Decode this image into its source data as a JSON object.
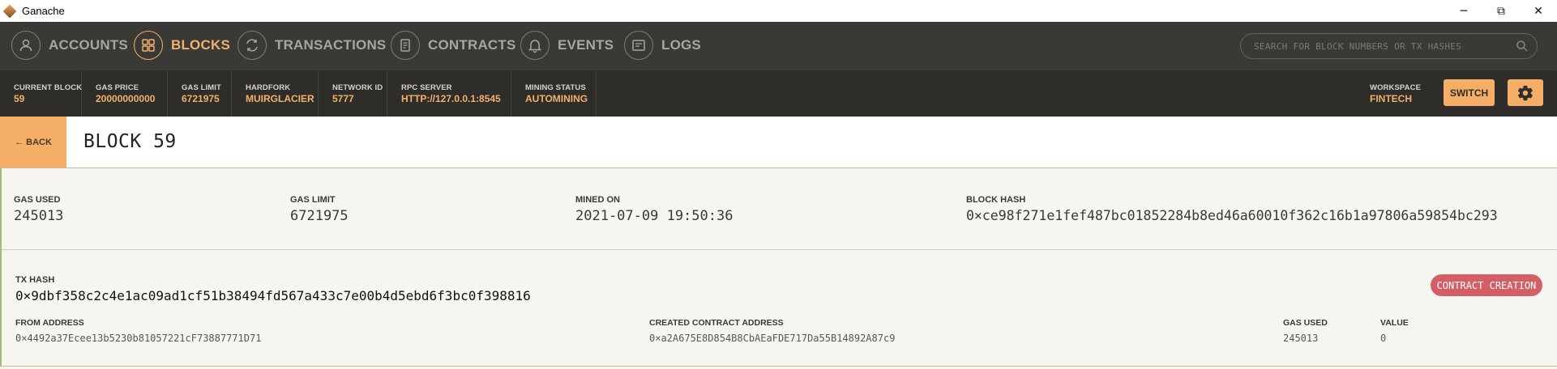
{
  "window": {
    "title": "Ganache",
    "minimize": "─",
    "maximize": "⧉",
    "close": "✕"
  },
  "nav": {
    "items": [
      {
        "label": "ACCOUNTS",
        "icon": "account-icon"
      },
      {
        "label": "BLOCKS",
        "icon": "blocks-icon",
        "active": true
      },
      {
        "label": "TRANSACTIONS",
        "icon": "transactions-icon"
      },
      {
        "label": "CONTRACTS",
        "icon": "contracts-icon"
      },
      {
        "label": "EVENTS",
        "icon": "bell-icon"
      },
      {
        "label": "LOGS",
        "icon": "logs-icon"
      }
    ],
    "search_placeholder": "SEARCH FOR BLOCK NUMBERS OR TX HASHES"
  },
  "status": {
    "current_block_label": "CURRENT BLOCK",
    "current_block": "59",
    "gas_price_label": "GAS PRICE",
    "gas_price": "20000000000",
    "gas_limit_label": "GAS LIMIT",
    "gas_limit": "6721975",
    "hardfork_label": "HARDFORK",
    "hardfork": "MUIRGLACIER",
    "network_id_label": "NETWORK ID",
    "network_id": "5777",
    "rpc_label": "RPC SERVER",
    "rpc": "HTTP://127.0.0.1:8545",
    "mining_label": "MINING STATUS",
    "mining": "AUTOMINING",
    "workspace_label": "WORKSPACE",
    "workspace": "FINTECH",
    "switch_label": "SWITCH"
  },
  "block": {
    "back_label": "← BACK",
    "title": "BLOCK 59",
    "gas_used_label": "GAS USED",
    "gas_used": "245013",
    "gas_limit_label": "GAS LIMIT",
    "gas_limit": "6721975",
    "mined_on_label": "MINED ON",
    "mined_on": "2021-07-09 19:50:36",
    "hash_label": "BLOCK HASH",
    "hash": "0×ce98f271e1fef487bc01852284b8ed46a60010f362c16b1a97806a59854bc293"
  },
  "transaction": {
    "hash_label": "TX HASH",
    "hash": "0×9dbf358c2c4e1ac09ad1cf51b38494fd567a433c7e00b4d5ebd6f3bc0f398816",
    "badge": "CONTRACT CREATION",
    "from_label": "FROM ADDRESS",
    "from": "0×4492a37Ecee13b5230b81057221cF73887771D71",
    "created_label": "CREATED CONTRACT ADDRESS",
    "created": "0×a2A675E8D854B8CbAEaFDE717Da55B14892A87c9",
    "gas_used_label": "GAS USED",
    "gas_used": "245013",
    "value_label": "VALUE",
    "value": "0"
  },
  "colors": {
    "accent": "#f0b16c",
    "nav_bg": "#3b3935",
    "status_bg": "#2f2d2a",
    "badge": "#d45e65"
  }
}
